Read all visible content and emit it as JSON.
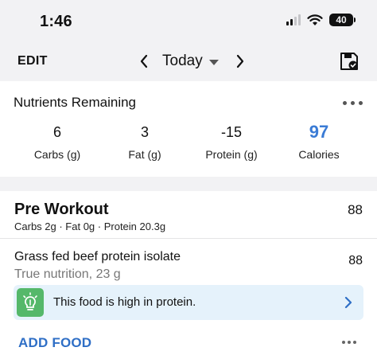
{
  "status": {
    "time": "1:46",
    "battery": "40"
  },
  "nav": {
    "edit": "EDIT",
    "date": "Today"
  },
  "nutrients": {
    "title": "Nutrients Remaining",
    "items": [
      {
        "value": "6",
        "label": "Carbs (g)"
      },
      {
        "value": "3",
        "label": "Fat (g)"
      },
      {
        "value": "-15",
        "label": "Protein (g)"
      },
      {
        "value": "97",
        "label": "Calories"
      }
    ],
    "calories_color": "#3a7bd5"
  },
  "meal": {
    "title": "Pre Workout",
    "calories": "88",
    "macros": "Carbs 2g · Fat 0g · Protein 20.3g",
    "food": {
      "name": "Grass fed beef protein isolate",
      "desc": "True nutrition, 23 g",
      "calories": "88"
    },
    "insight": {
      "text": "This food is high in protein.",
      "icon": "lightbulb-icon",
      "color": "#55b86a"
    },
    "add_food": "ADD FOOD",
    "accent": "#2f6fc6"
  }
}
